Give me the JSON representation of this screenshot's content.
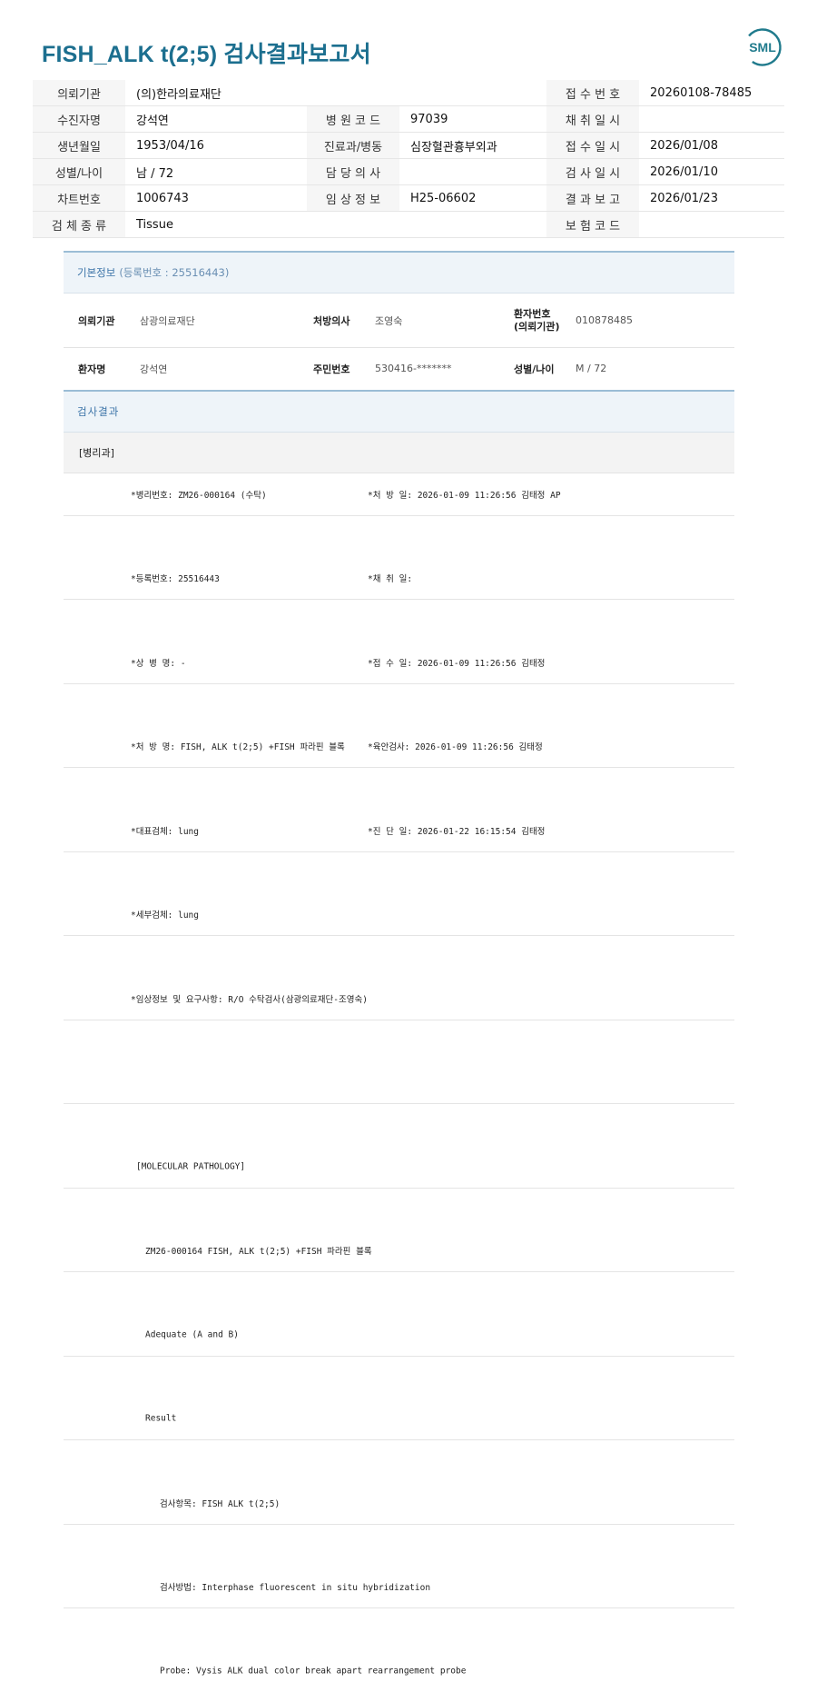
{
  "title": "FISH_ALK t(2;5) 검사결과보고서",
  "logo_text": "SML",
  "header": {
    "r1": {
      "k1": "의뢰기관",
      "v1": "(의)한라의료재단",
      "k3": "접 수 번 호",
      "v3": "20260108-78485"
    },
    "r2": {
      "k1": "수진자명",
      "v1": "강석연",
      "k2": "병 원 코 드",
      "v2": "97039",
      "k3": "채 취 일 시",
      "v3": ""
    },
    "r3": {
      "k1": "생년월일",
      "v1": "1953/04/16",
      "k2": "진료과/병동",
      "v2": "심장혈관흉부외과",
      "k3": "접 수 일 시",
      "v3": "2026/01/08"
    },
    "r4": {
      "k1": "성별/나이",
      "v1": "남 / 72",
      "k2": "담 당 의 사",
      "v2": "",
      "k3": "검 사 일 시",
      "v3": "2026/01/10"
    },
    "r5": {
      "k1": "차트번호",
      "v1": "1006743",
      "k2": "임 상 정 보",
      "v2": "H25-06602",
      "k3": "결 과 보 고",
      "v3": "2026/01/23"
    },
    "r6": {
      "k1": "검 체 종 류",
      "v1": "Tissue",
      "k3": "보 험 코 드",
      "v3": ""
    }
  },
  "basic": {
    "title": "기본정보",
    "sub": "(등록번호 : 25516443)",
    "inst_label": "의뢰기관",
    "inst": "삼광의료재단",
    "doc_label": "처방의사",
    "doc": "조영숙",
    "pid_label1": "환자번호",
    "pid_label2": "(의뢰기관)",
    "pid": "010878485",
    "name_label": "환자명",
    "name": "강석연",
    "rrn_label": "주민번호",
    "rrn": "530416-*******",
    "sex_label": "성별/나이",
    "sex": "M / 72"
  },
  "result": {
    "title": "검사결과",
    "dept": "[병리과]",
    "rows": [
      {
        "a": "*병리번호: ZM26-000164 (수탁)",
        "b": "*처 방 일: 2026-01-09 11:26:56  김태정 AP"
      },
      {
        "a": "*등록번호: 25516443",
        "b": "*채 취 일:"
      },
      {
        "a": "*상 병 명: -",
        "b": "*접 수 일: 2026-01-09 11:26:56  김태정"
      },
      {
        "a": "*처 방 명: FISH, ALK t(2;5) +FISH 파라핀 블록",
        "b": "*육안검사: 2026-01-09 11:26:56  김태정"
      },
      {
        "a": "*대표검체: lung",
        "b": "*진 단 일: 2026-01-22 16:15:54  김태정"
      },
      {
        "a": "*세부검체: lung",
        "b": ""
      },
      {
        "a": "*임상정보 및 요구사항: R/O 수탁검사(삼광의료재단-조영숙)",
        "b": ""
      },
      {
        "a": "",
        "b": ""
      }
    ],
    "mol": [
      "[MOLECULAR PATHOLOGY]",
      "ZM26-000164     FISH, ALK t(2;5) +FISH 파라핀 블록",
      "Adequate (A and B)",
      "Result",
      "검사항목: FISH ALK t(2;5)",
      "검사방법: Interphase fluorescent in situ hybridization",
      "Probe: Vysis ALK dual color break apart rearrangement probe"
    ]
  },
  "colors": {
    "title": "#1c6f8f",
    "section": "#3c74a8",
    "logo": "#1f7a8c"
  }
}
